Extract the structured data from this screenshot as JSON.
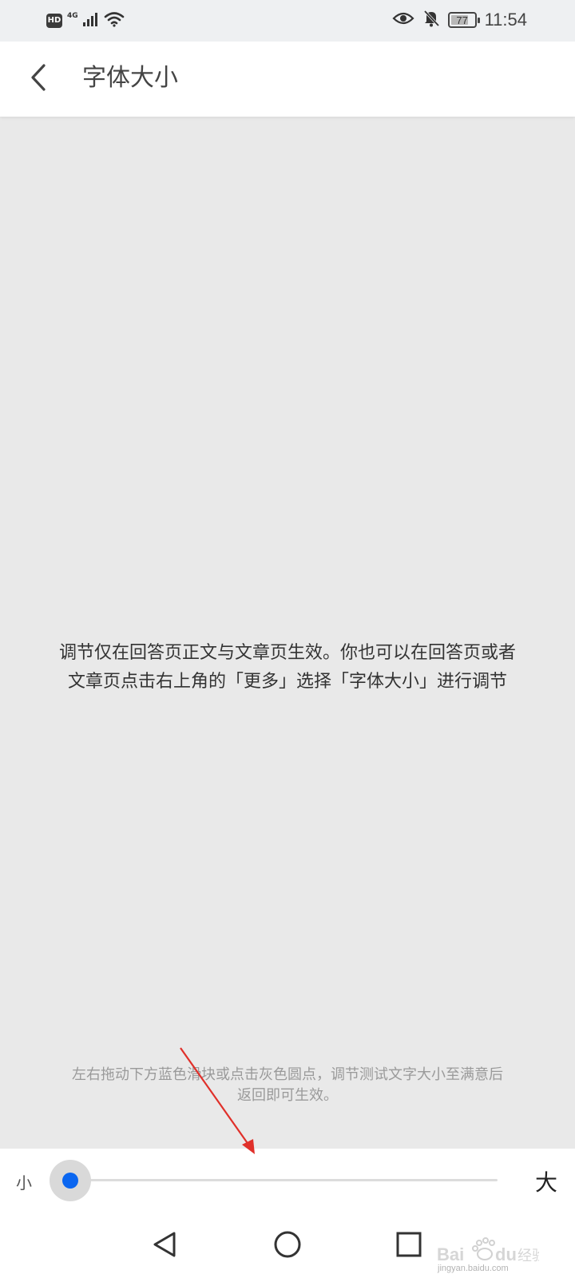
{
  "status_bar": {
    "hd_badge": "HD",
    "network_type": "4G",
    "battery_level": "77",
    "battery_fraction": 0.77,
    "time": "11:54",
    "icons": [
      "hd-icon",
      "signal-icon",
      "wifi-icon",
      "eye-icon",
      "bell-off-icon",
      "battery-icon"
    ]
  },
  "header": {
    "title": "字体大小",
    "back_icon": "chevron-left-icon"
  },
  "preview": {
    "line1": "调节仅在回答页正文与文章页生效。你也可以在回答页或者",
    "line2": "文章页点击右上角的「更多」选择「字体大小」进行调节"
  },
  "hint": {
    "line1": "左右拖动下方蓝色滑块或点击灰色圆点，调节测试文字大小至满意后",
    "line2": "返回即可生效。"
  },
  "slider": {
    "label_small": "小",
    "label_large": "大",
    "value_fraction": 0.0,
    "thumb_color": "#0a66f0",
    "halo_color": "#d9d9d9",
    "track_color": "#dcdcdc"
  },
  "annotation": {
    "arrow_color": "#e0302a"
  },
  "navigation": {
    "back_icon": "triangle-back-icon",
    "home_icon": "circle-home-icon",
    "recents_icon": "square-recents-icon"
  },
  "watermark": {
    "text": "jingyan.baidu.com"
  },
  "colors": {
    "page_background": "#e9e9e9",
    "bar_background": "#ffffff",
    "status_background": "#eef0f2"
  }
}
